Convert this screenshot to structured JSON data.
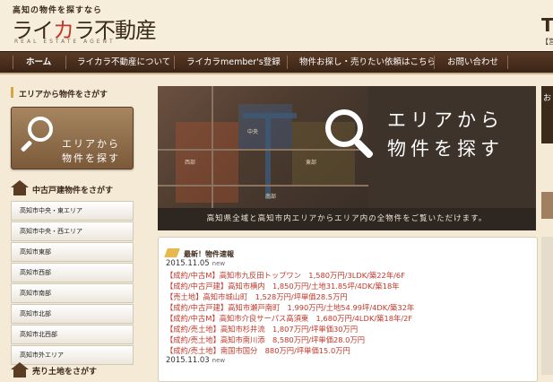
{
  "header": {
    "tagline": "高知の物件を探すなら",
    "logo_pre": "ライ",
    "logo_ka": "カ",
    "logo_post": "ラ不動産",
    "logo_en": "REAL ESTATE AGENT",
    "tel_fragment": "T",
    "tel_sub_fragment": "【営"
  },
  "nav": {
    "items": [
      {
        "label": "ホーム"
      },
      {
        "label": "ライカラ不動産について"
      },
      {
        "label": "ライカラmember's登録"
      },
      {
        "label": "物件お探し・売りたい依頼はこちら"
      },
      {
        "label": "お問い合わせ"
      }
    ]
  },
  "sidebar": {
    "area_section_title": "エリアから物件をさがす",
    "area_button_line1": "エリアから",
    "area_button_line2": "物件を探す",
    "house_section_title": "中古戸建物件をさがす",
    "areas": [
      "高知市中央・東エリア",
      "高知市中央・西エリア",
      "高知市東部",
      "高知市西部",
      "高知市南部",
      "高知市北部",
      "高知市北西部",
      "高知市外エリア"
    ],
    "land_section_title": "売り土地をさがす"
  },
  "banner": {
    "title_line1": "エリアから",
    "title_line2": "物件を探す",
    "caption": "高知県全域と高知市内エリアからエリア内の全物件をご覧いただけます。",
    "map_labels": [
      "中央",
      "東部",
      "西部",
      "南部"
    ],
    "right_partial": "お"
  },
  "news": {
    "heading": "最新！物件速報",
    "groups": [
      {
        "date": "2015.11.05",
        "badge": "new",
        "items": [
          "【成約/中古M】高知市九反田トップワン　1,580万円/3LDK/築22年/6F",
          "【成約/中古戸建】高知市横内　1,850万円/土地31.85坪/4DK/築18年",
          "【売土地】高知市城山町　1,528万円/坪単価28.5万円",
          "【成約/中古戸建】高知市瀬戸南町　1,990万円/土地54.99坪/4DK/築32年",
          "【成約/中古M】高知市介良サーパス高須東　1,680万円/4LDK/築18年/2F",
          "【成約/売土地】高知市杉井流　1,807万円/坪単価30万円",
          "【成約/売土地】高知市南川添　8,580万円/坪単価28.0万円",
          "【成約/売土地】南国市国分　880万円/坪単価15.0万円"
        ]
      },
      {
        "date": "2015.11.03",
        "badge": "new",
        "items": []
      }
    ]
  }
}
